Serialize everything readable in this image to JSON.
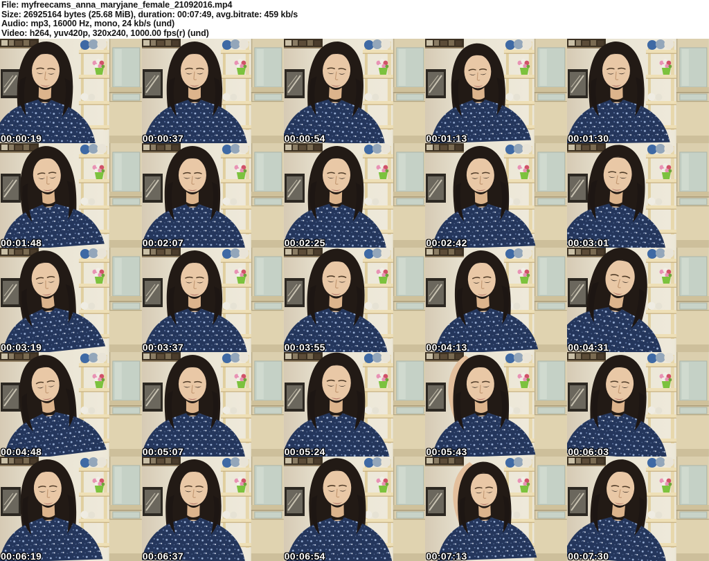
{
  "header": {
    "lines": [
      "File: myfreecams_anna_maryjane_female_21092016.mp4",
      "Size: 26925164 bytes (25.68 MiB), duration: 00:07:49, avg.bitrate: 459 kb/s",
      "Audio: mp3, 16000 Hz, mono, 24 kb/s (und)",
      "Video: h264, yuv420p, 320x240, 1000.00 fps(r) (und)"
    ]
  },
  "thumbnails": [
    {
      "timestamp": "00:00:19"
    },
    {
      "timestamp": "00:00:37"
    },
    {
      "timestamp": "00:00:54"
    },
    {
      "timestamp": "00:01:13"
    },
    {
      "timestamp": "00:01:30"
    },
    {
      "timestamp": "00:01:48"
    },
    {
      "timestamp": "00:02:07"
    },
    {
      "timestamp": "00:02:25"
    },
    {
      "timestamp": "00:02:42"
    },
    {
      "timestamp": "00:03:01"
    },
    {
      "timestamp": "00:03:19"
    },
    {
      "timestamp": "00:03:37"
    },
    {
      "timestamp": "00:03:55"
    },
    {
      "timestamp": "00:04:13"
    },
    {
      "timestamp": "00:04:31"
    },
    {
      "timestamp": "00:04:48"
    },
    {
      "timestamp": "00:05:07"
    },
    {
      "timestamp": "00:05:24"
    },
    {
      "timestamp": "00:05:43"
    },
    {
      "timestamp": "00:06:03"
    },
    {
      "timestamp": "00:06:19"
    },
    {
      "timestamp": "00:06:37"
    },
    {
      "timestamp": "00:06:54"
    },
    {
      "timestamp": "00:07:13"
    },
    {
      "timestamp": "00:07:30"
    }
  ],
  "colors": {
    "header_text": "#141414",
    "timestamp_text": "#ffffff",
    "timestamp_outline": "#000000",
    "wall": "#e9e4d4",
    "dress_navy": "#24365c",
    "hair": "#221a15",
    "skin": "#e9c8a6",
    "shelf_wood": "#eedfb6",
    "cabinet_glass": "#c5d1c6",
    "flower_pot": "#7cc23e",
    "yarn_blue": "#3e69a4",
    "yarn_gray": "#93a6ba",
    "yarn_white": "#e9e4d7"
  }
}
